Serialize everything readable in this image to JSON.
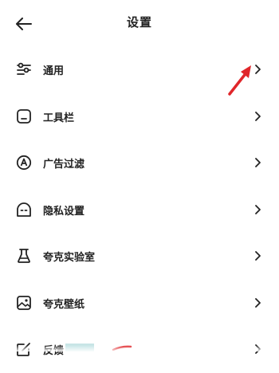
{
  "header": {
    "title": "设置",
    "back_icon": "arrow-left-icon"
  },
  "menu": {
    "items": [
      {
        "label": "通用",
        "icon": "sliders-icon"
      },
      {
        "label": "工具栏",
        "icon": "toolbar-icon"
      },
      {
        "label": "广告过滤",
        "icon": "ad-filter-icon"
      },
      {
        "label": "隐私设置",
        "icon": "privacy-icon"
      },
      {
        "label": "夸克实验室",
        "icon": "lab-flask-icon"
      },
      {
        "label": "夸克壁纸",
        "icon": "wallpaper-icon"
      },
      {
        "label": "反馈",
        "icon": "feedback-icon"
      }
    ]
  },
  "colors": {
    "text": "#222222",
    "annotation_arrow": "#e0262a",
    "background": "#ffffff"
  }
}
